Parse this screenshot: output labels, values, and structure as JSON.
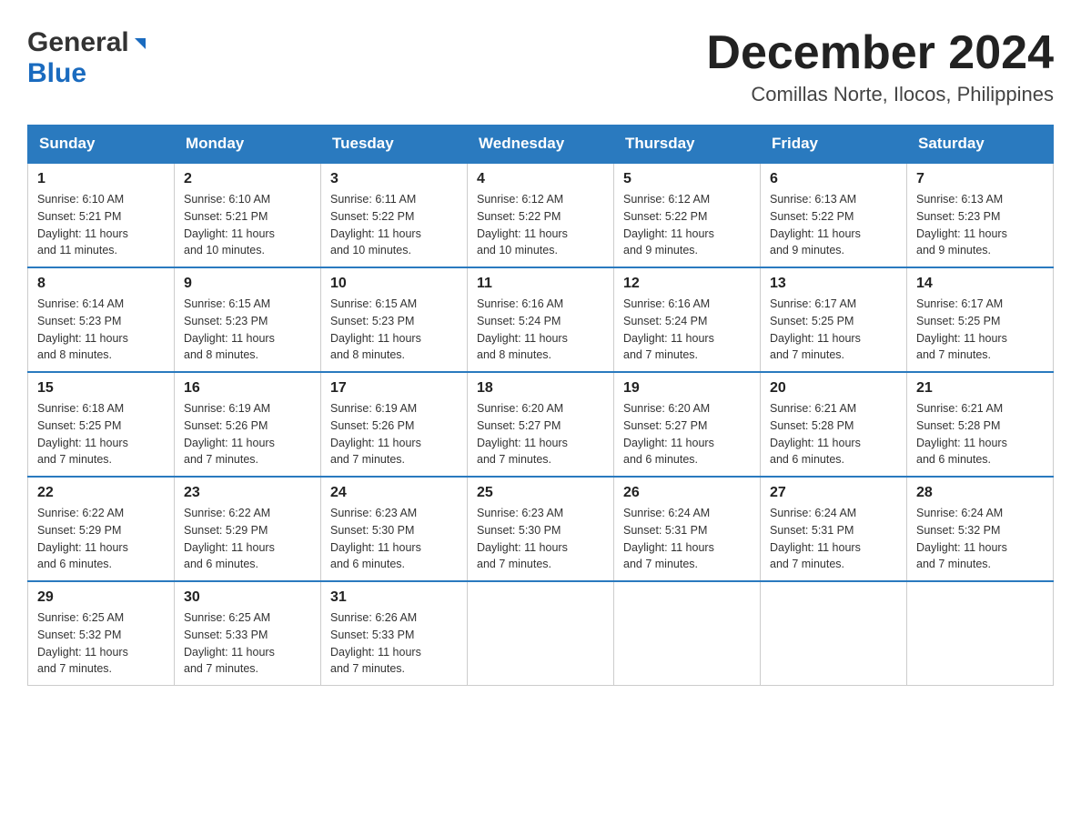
{
  "header": {
    "logo_general": "General",
    "logo_blue": "Blue",
    "month_title": "December 2024",
    "subtitle": "Comillas Norte, Ilocos, Philippines"
  },
  "days_of_week": [
    "Sunday",
    "Monday",
    "Tuesday",
    "Wednesday",
    "Thursday",
    "Friday",
    "Saturday"
  ],
  "weeks": [
    [
      {
        "day": "1",
        "sunrise": "6:10 AM",
        "sunset": "5:21 PM",
        "daylight": "11 hours and 11 minutes."
      },
      {
        "day": "2",
        "sunrise": "6:10 AM",
        "sunset": "5:21 PM",
        "daylight": "11 hours and 10 minutes."
      },
      {
        "day": "3",
        "sunrise": "6:11 AM",
        "sunset": "5:22 PM",
        "daylight": "11 hours and 10 minutes."
      },
      {
        "day": "4",
        "sunrise": "6:12 AM",
        "sunset": "5:22 PM",
        "daylight": "11 hours and 10 minutes."
      },
      {
        "day": "5",
        "sunrise": "6:12 AM",
        "sunset": "5:22 PM",
        "daylight": "11 hours and 9 minutes."
      },
      {
        "day": "6",
        "sunrise": "6:13 AM",
        "sunset": "5:22 PM",
        "daylight": "11 hours and 9 minutes."
      },
      {
        "day": "7",
        "sunrise": "6:13 AM",
        "sunset": "5:23 PM",
        "daylight": "11 hours and 9 minutes."
      }
    ],
    [
      {
        "day": "8",
        "sunrise": "6:14 AM",
        "sunset": "5:23 PM",
        "daylight": "11 hours and 8 minutes."
      },
      {
        "day": "9",
        "sunrise": "6:15 AM",
        "sunset": "5:23 PM",
        "daylight": "11 hours and 8 minutes."
      },
      {
        "day": "10",
        "sunrise": "6:15 AM",
        "sunset": "5:23 PM",
        "daylight": "11 hours and 8 minutes."
      },
      {
        "day": "11",
        "sunrise": "6:16 AM",
        "sunset": "5:24 PM",
        "daylight": "11 hours and 8 minutes."
      },
      {
        "day": "12",
        "sunrise": "6:16 AM",
        "sunset": "5:24 PM",
        "daylight": "11 hours and 7 minutes."
      },
      {
        "day": "13",
        "sunrise": "6:17 AM",
        "sunset": "5:25 PM",
        "daylight": "11 hours and 7 minutes."
      },
      {
        "day": "14",
        "sunrise": "6:17 AM",
        "sunset": "5:25 PM",
        "daylight": "11 hours and 7 minutes."
      }
    ],
    [
      {
        "day": "15",
        "sunrise": "6:18 AM",
        "sunset": "5:25 PM",
        "daylight": "11 hours and 7 minutes."
      },
      {
        "day": "16",
        "sunrise": "6:19 AM",
        "sunset": "5:26 PM",
        "daylight": "11 hours and 7 minutes."
      },
      {
        "day": "17",
        "sunrise": "6:19 AM",
        "sunset": "5:26 PM",
        "daylight": "11 hours and 7 minutes."
      },
      {
        "day": "18",
        "sunrise": "6:20 AM",
        "sunset": "5:27 PM",
        "daylight": "11 hours and 7 minutes."
      },
      {
        "day": "19",
        "sunrise": "6:20 AM",
        "sunset": "5:27 PM",
        "daylight": "11 hours and 6 minutes."
      },
      {
        "day": "20",
        "sunrise": "6:21 AM",
        "sunset": "5:28 PM",
        "daylight": "11 hours and 6 minutes."
      },
      {
        "day": "21",
        "sunrise": "6:21 AM",
        "sunset": "5:28 PM",
        "daylight": "11 hours and 6 minutes."
      }
    ],
    [
      {
        "day": "22",
        "sunrise": "6:22 AM",
        "sunset": "5:29 PM",
        "daylight": "11 hours and 6 minutes."
      },
      {
        "day": "23",
        "sunrise": "6:22 AM",
        "sunset": "5:29 PM",
        "daylight": "11 hours and 6 minutes."
      },
      {
        "day": "24",
        "sunrise": "6:23 AM",
        "sunset": "5:30 PM",
        "daylight": "11 hours and 6 minutes."
      },
      {
        "day": "25",
        "sunrise": "6:23 AM",
        "sunset": "5:30 PM",
        "daylight": "11 hours and 7 minutes."
      },
      {
        "day": "26",
        "sunrise": "6:24 AM",
        "sunset": "5:31 PM",
        "daylight": "11 hours and 7 minutes."
      },
      {
        "day": "27",
        "sunrise": "6:24 AM",
        "sunset": "5:31 PM",
        "daylight": "11 hours and 7 minutes."
      },
      {
        "day": "28",
        "sunrise": "6:24 AM",
        "sunset": "5:32 PM",
        "daylight": "11 hours and 7 minutes."
      }
    ],
    [
      {
        "day": "29",
        "sunrise": "6:25 AM",
        "sunset": "5:32 PM",
        "daylight": "11 hours and 7 minutes."
      },
      {
        "day": "30",
        "sunrise": "6:25 AM",
        "sunset": "5:33 PM",
        "daylight": "11 hours and 7 minutes."
      },
      {
        "day": "31",
        "sunrise": "6:26 AM",
        "sunset": "5:33 PM",
        "daylight": "11 hours and 7 minutes."
      },
      null,
      null,
      null,
      null
    ]
  ],
  "labels": {
    "sunrise": "Sunrise:",
    "sunset": "Sunset:",
    "daylight": "Daylight:"
  },
  "colors": {
    "header_bg": "#2a7abf",
    "accent": "#1a6bbf"
  }
}
